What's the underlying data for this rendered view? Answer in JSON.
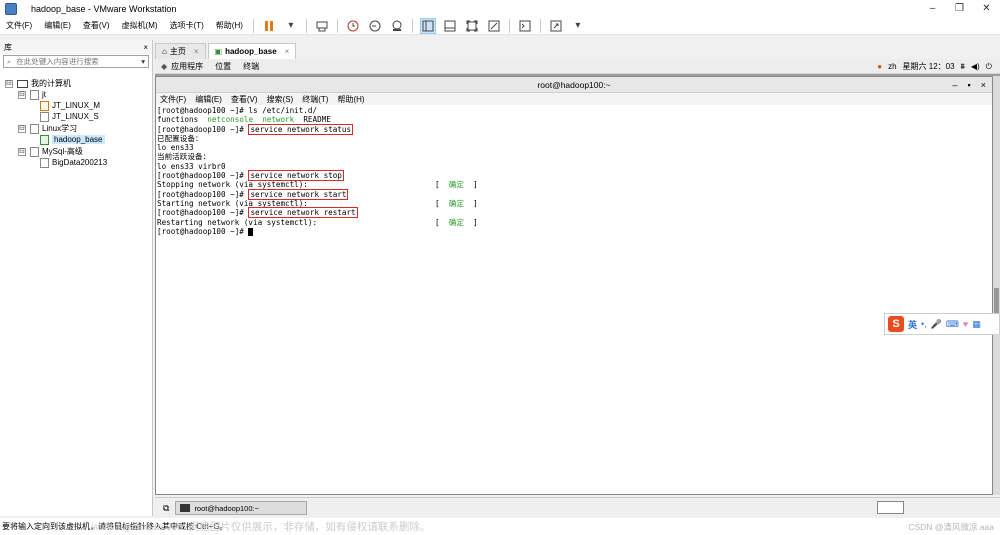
{
  "window": {
    "title": "hadoop_base - VMware Workstation",
    "controls": [
      "–",
      "❐",
      "✕"
    ]
  },
  "menubar": {
    "items": [
      "文件(F)",
      "编辑(E)",
      "查看(V)",
      "虚拟机(M)",
      "选项卡(T)",
      "帮助(H)"
    ]
  },
  "library": {
    "title": "库",
    "close": "×",
    "search_placeholder": "在此处键入内容进行搜索",
    "tree": [
      {
        "label": "我的计算机"
      },
      {
        "label": "jt"
      },
      {
        "label": "JT_LINUX_M"
      },
      {
        "label": "JT_LINUX_S"
      },
      {
        "label": "Linux学习"
      },
      {
        "label": "hadoop_base"
      },
      {
        "label": "MySql-高级"
      },
      {
        "label": "BigData200213"
      }
    ],
    "expanders": [
      "⊟",
      "⊟",
      "⊟",
      "⊟"
    ]
  },
  "tabs": [
    {
      "label": "主页",
      "close": "×"
    },
    {
      "label": "hadoop_base",
      "close": "×"
    }
  ],
  "guest": {
    "menu": [
      "应用程序",
      "位置",
      "终端"
    ],
    "lang": "zh",
    "clock": "星期六 12：03"
  },
  "terminal": {
    "title": "root@hadoop100:~",
    "menu": [
      "文件(F)",
      "编辑(E)",
      "查看(V)",
      "搜索(S)",
      "终端(T)",
      "帮助(H)"
    ],
    "prompt": "[root@hadoop100 ~]# ",
    "lines": {
      "l1_cmd": "ls /etc/init.d/",
      "l2_a": "functions",
      "l2_b": "netconsole",
      "l2_c": "network",
      "l2_d": "README",
      "l3_cmd": "service network status",
      "l4": "已配置设备：",
      "l5": "lo ens33",
      "l6": "当前活跃设备：",
      "l7": "lo ens33 virbr0",
      "l8_cmd": "service network stop",
      "l9": "Stopping network (via systemctl):",
      "l10_cmd": "service network start",
      "l11": "Starting network (via systemctl):",
      "l12_cmd": "service network restart",
      "l13": "Restarting network (via systemctl):",
      "ok_open": "[",
      "ok_text": "确定",
      "ok_close": "]"
    }
  },
  "ime": {
    "logo": "S",
    "label": "英"
  },
  "taskbar": {
    "task": "root@hadoop100:~"
  },
  "status": {
    "text": "要将输入定向到该虚拟机，请将鼠标指针移入其中或按 Ctrl+G。",
    "watermark_left": "www.toymoban.com 网络图片仅供展示，非存储，如有侵权请联系删除。",
    "watermark_right": "CSDN @清风微凉 aaa"
  },
  "colors": {
    "highlight_box": "#d62b2b",
    "ok_green": "#2b9d2b",
    "dir_blue": "#2c6fd6",
    "ime_orange": "#e84d1e"
  }
}
